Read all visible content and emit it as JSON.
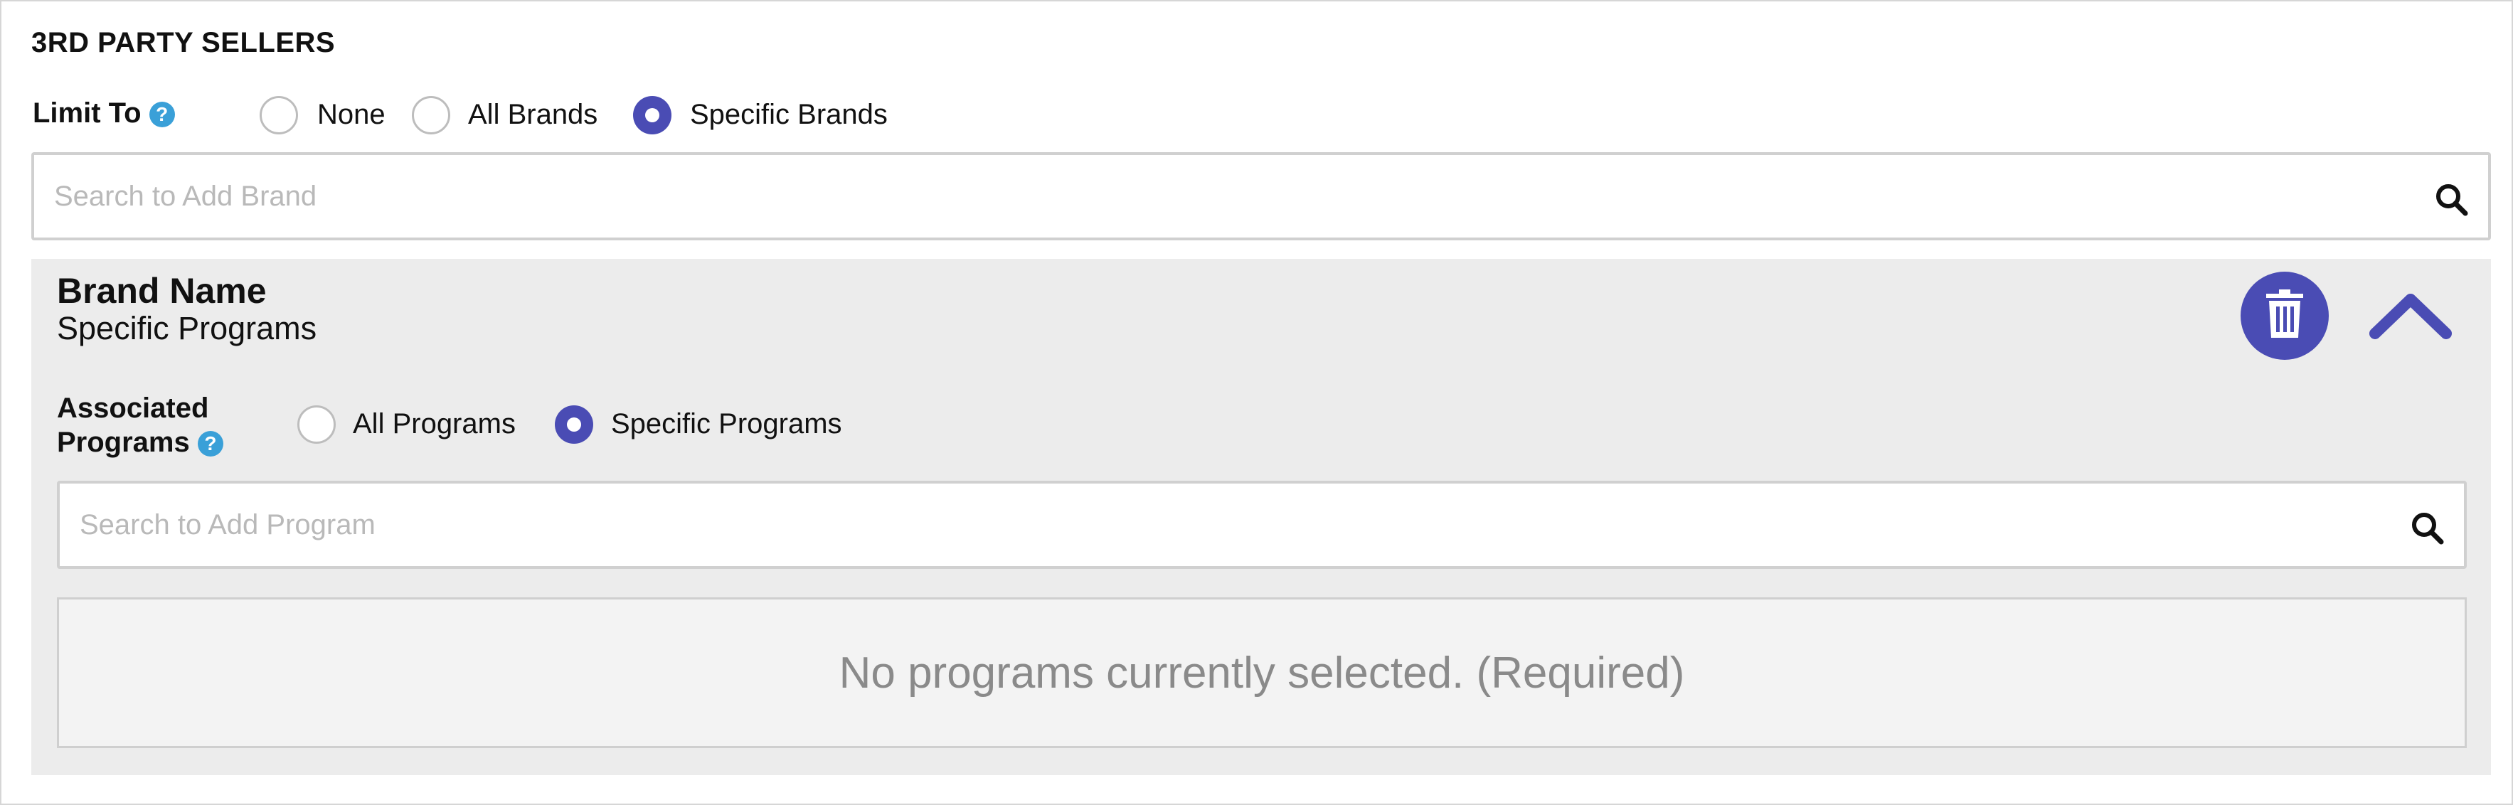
{
  "section": {
    "title": "3RD PARTY SELLERS"
  },
  "limit_to": {
    "label": "Limit To",
    "help_glyph": "?",
    "options": [
      {
        "label": "None",
        "checked": false
      },
      {
        "label": "All Brands",
        "checked": false
      },
      {
        "label": "Specific Brands",
        "checked": true
      }
    ]
  },
  "brand_search": {
    "placeholder": "Search to Add Brand",
    "value": "",
    "icon": "search-icon"
  },
  "brand": {
    "name": "Brand Name",
    "subtitle": "Specific Programs",
    "delete_icon": "trash-icon",
    "collapse_icon": "chevron-up-icon",
    "associated_programs": {
      "label_line1": "Associated",
      "label_line2": "Programs",
      "help_glyph": "?",
      "options": [
        {
          "label": "All Programs",
          "checked": false
        },
        {
          "label": "Specific Programs",
          "checked": true
        }
      ]
    },
    "program_search": {
      "placeholder": "Search to Add Program",
      "value": "",
      "icon": "search-icon"
    },
    "empty_message": "No programs currently selected. (Required)"
  },
  "colors": {
    "accent": "#4a4cb4",
    "help": "#3aa0d8",
    "panel_bg": "#ececec",
    "muted_text": "#8a8a8a"
  }
}
